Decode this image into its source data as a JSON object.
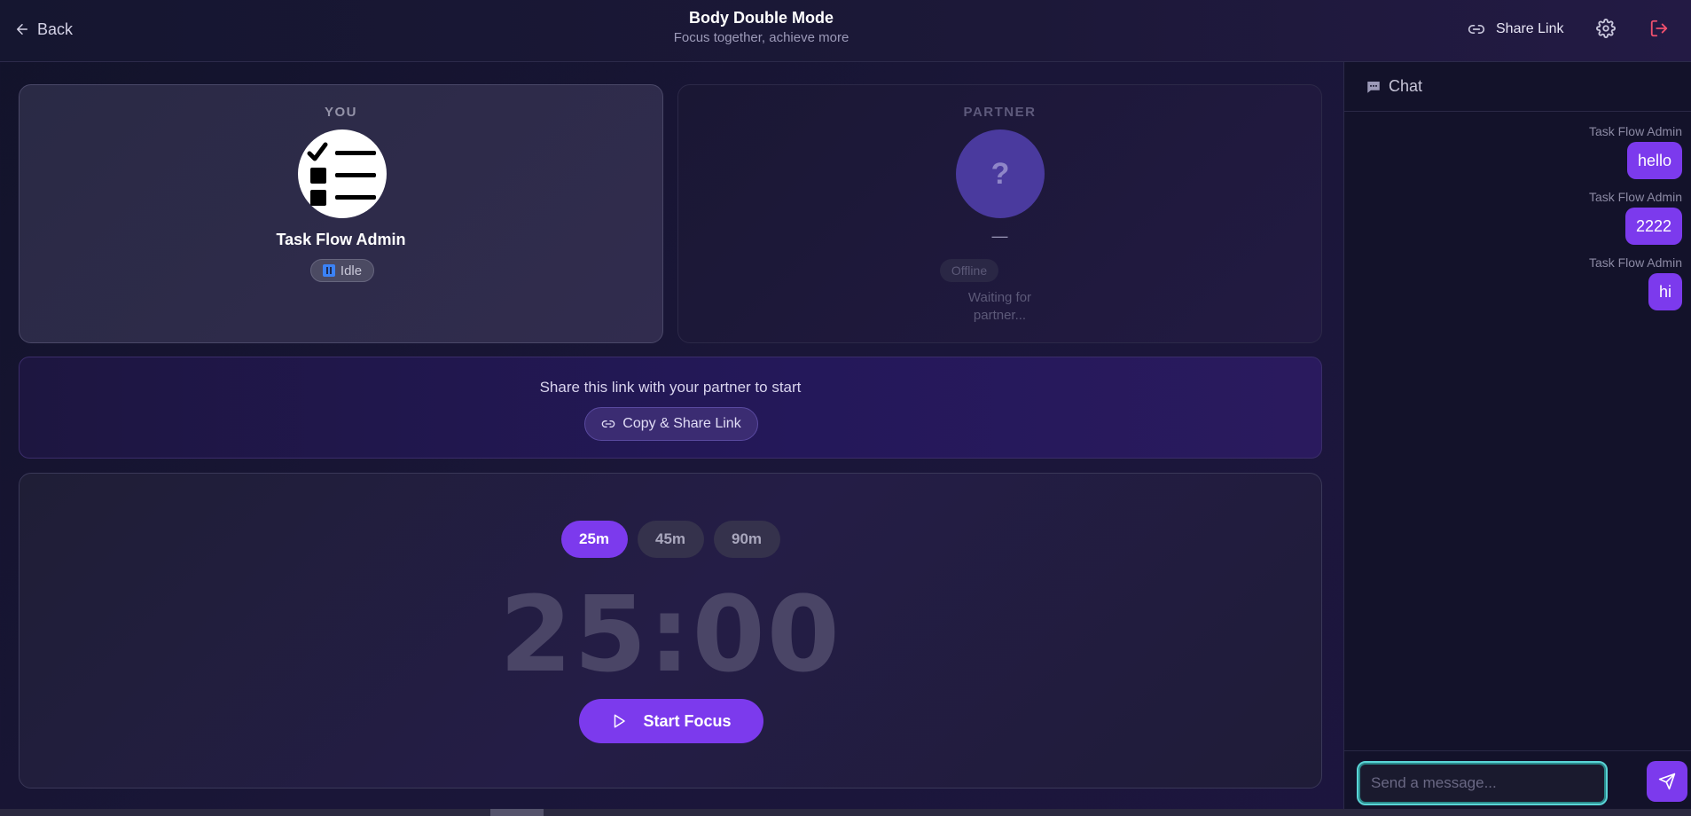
{
  "header": {
    "back_label": "Back",
    "title": "Body Double Mode",
    "subtitle": "Focus together, achieve more",
    "share_label": "Share Link"
  },
  "you_card": {
    "label": "YOU",
    "name": "Task Flow Admin",
    "status": "Idle"
  },
  "partner_card": {
    "label": "PARTNER",
    "avatar_glyph": "?",
    "name": "—",
    "status": "Offline",
    "waiting_line1": "Waiting for",
    "waiting_line2": "partner..."
  },
  "share_banner": {
    "text": "Share this link with your partner to start",
    "button_label": "Copy & Share Link"
  },
  "timer": {
    "durations": [
      "25m",
      "45m",
      "90m"
    ],
    "selected": "25m",
    "display": "25:00",
    "start_label": "Start Focus"
  },
  "chat": {
    "title": "Chat",
    "messages": [
      {
        "sender": "Task Flow Admin",
        "text": "hello"
      },
      {
        "sender": "Task Flow Admin",
        "text": "2222"
      },
      {
        "sender": "Task Flow Admin",
        "text": "hi"
      }
    ],
    "input_placeholder": "Send a message..."
  },
  "colors": {
    "accent": "#7c3aed",
    "background": "#1a1638",
    "input_focus": "#5ad4d6",
    "logout": "#f0506e"
  }
}
